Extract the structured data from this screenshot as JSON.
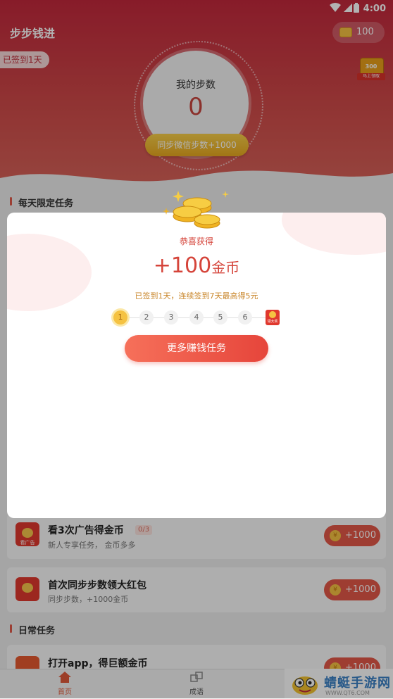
{
  "status_bar": {
    "time": "4:00"
  },
  "header": {
    "title": "步步钱进",
    "coin_balance": "100",
    "signed_badge": "已签到1天",
    "chest": {
      "amount": "300",
      "label": "马上领取"
    }
  },
  "steps": {
    "label": "我的步数",
    "value": "0",
    "sync_button": "同步微信步数+1000"
  },
  "daily_limited": {
    "title": "每天限定任务"
  },
  "tasks": [
    {
      "title": "看3次广告得金币",
      "progress": "0/3",
      "subtitle": "新人专享任务， 金币多多",
      "icon_label": "看广告",
      "reward": "+1000"
    },
    {
      "title": "首次同步步数领大红包",
      "subtitle": "同步步数，+1000金币",
      "reward": "+1000"
    }
  ],
  "daily_tasks": {
    "title": "日常任务"
  },
  "daily_task_list": [
    {
      "title": "打开app，得巨额金币",
      "reward": "+1000"
    }
  ],
  "popup": {
    "congrats": "恭喜获得",
    "amount": "+100",
    "unit": "金币",
    "note": "已签到1天，连续签到7天最高得5元",
    "days": [
      "1",
      "2",
      "3",
      "4",
      "5",
      "6"
    ],
    "gift_label": "领大奖",
    "button": "更多赚钱任务"
  },
  "bottom_nav": [
    {
      "label": "首页",
      "active": true
    },
    {
      "label": "成语",
      "active": false
    }
  ],
  "watermark": {
    "title": "蜻蜓手游网",
    "url": "WWW.QT6.COM"
  },
  "colors": {
    "header_red": "#c2283c",
    "accent_red": "#e35848",
    "gold": "#f5c242"
  }
}
